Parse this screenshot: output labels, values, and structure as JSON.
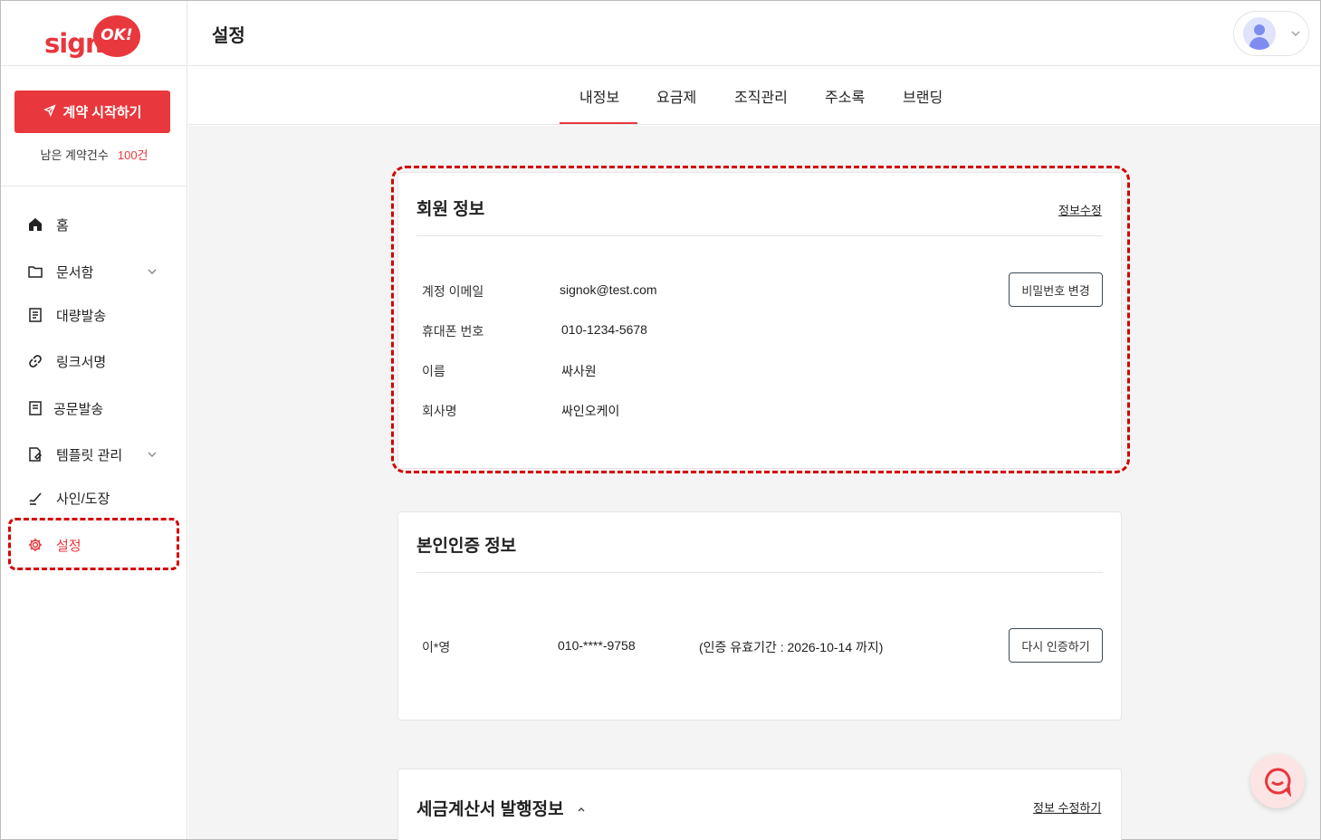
{
  "brand": {
    "logo_text": "sign",
    "logo_badge": "OK!",
    "accent": "#e8373d"
  },
  "sidebar": {
    "start_button": "계약 시작하기",
    "remaining_label": "남은 계약건수",
    "remaining_count": "100건",
    "items": [
      {
        "label": "홈",
        "icon": "home-icon"
      },
      {
        "label": "문서함",
        "icon": "folder-icon",
        "expandable": true
      },
      {
        "label": "대량발송",
        "icon": "bulk-send-icon"
      },
      {
        "label": "링크서명",
        "icon": "link-icon"
      },
      {
        "label": "공문발송",
        "icon": "document-icon"
      },
      {
        "label": "템플릿 관리",
        "icon": "template-icon",
        "expandable": true
      },
      {
        "label": "사인/도장",
        "icon": "signature-icon"
      },
      {
        "label": "설정",
        "icon": "gear-icon",
        "active": true
      }
    ]
  },
  "header": {
    "title": "설정"
  },
  "tabs": [
    {
      "label": "내정보",
      "active": true
    },
    {
      "label": "요금제"
    },
    {
      "label": "조직관리"
    },
    {
      "label": "주소록"
    },
    {
      "label": "브랜딩"
    }
  ],
  "member_info": {
    "title": "회원 정보",
    "edit_link": "정보수정",
    "change_password_button": "비밀번호 변경",
    "fields": [
      {
        "label": "계정 이메일",
        "value": "signok@test.com"
      },
      {
        "label": "휴대폰 번호",
        "value": "010-1234-5678"
      },
      {
        "label": "이름",
        "value": "싸사원"
      },
      {
        "label": "회사명",
        "value": "싸인오케이"
      }
    ]
  },
  "identity_info": {
    "title": "본인인증 정보",
    "name": "이*영",
    "phone": "010-****-9758",
    "validity": "(인증 유효기간 : 2026-10-14 까지)",
    "reverify_button": "다시 인증하기"
  },
  "tax_invoice": {
    "title": "세금계산서 발행정보",
    "edit_link": "정보 수정하기"
  }
}
